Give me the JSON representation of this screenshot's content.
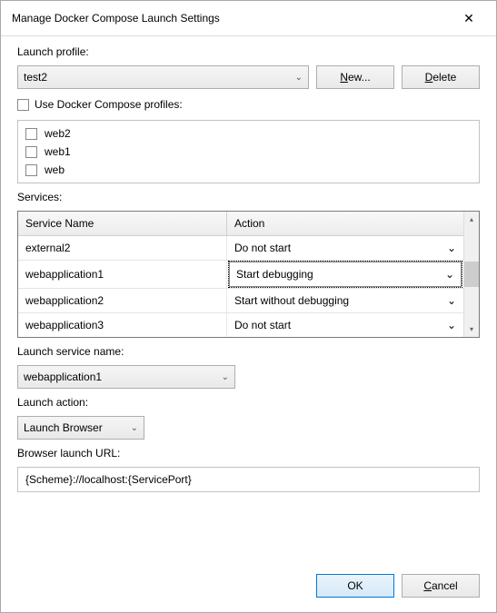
{
  "window": {
    "title": "Manage Docker Compose Launch Settings"
  },
  "labels": {
    "launch_profile": "Launch profile:",
    "use_profiles": "Use Docker Compose profiles:",
    "services": "Services:",
    "service_name_header": "Service Name",
    "action_header": "Action",
    "launch_service_name": "Launch service name:",
    "launch_action": "Launch action:",
    "browser_launch_url": "Browser launch URL:"
  },
  "profile_select": {
    "value": "test2"
  },
  "buttons": {
    "new": "New...",
    "delete": "Delete",
    "ok": "OK",
    "cancel": "Cancel"
  },
  "compose_profiles": {
    "enabled": false,
    "items": [
      {
        "label": "web2",
        "checked": false
      },
      {
        "label": "web1",
        "checked": false
      },
      {
        "label": "web",
        "checked": false
      }
    ]
  },
  "services_table": {
    "rows": [
      {
        "name": "external2",
        "action": "Do not start",
        "focused": false
      },
      {
        "name": "webapplication1",
        "action": "Start debugging",
        "focused": true
      },
      {
        "name": "webapplication2",
        "action": "Start without debugging",
        "focused": false
      },
      {
        "name": "webapplication3",
        "action": "Do not start",
        "focused": false
      }
    ]
  },
  "launch_service_name": {
    "value": "webapplication1"
  },
  "launch_action": {
    "value": "Launch Browser"
  },
  "browser_url": {
    "value": "{Scheme}://localhost:{ServicePort}"
  }
}
